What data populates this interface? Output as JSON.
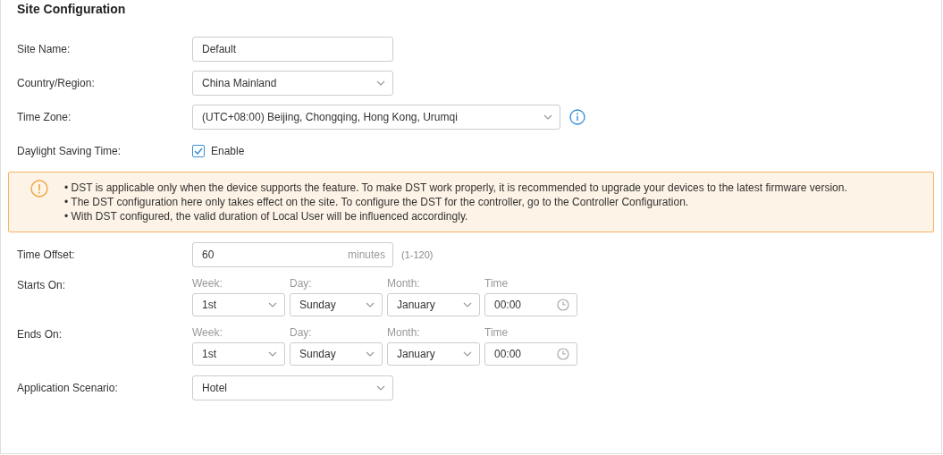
{
  "title": "Site Configuration",
  "site_name": {
    "label": "Site Name:",
    "value": "Default"
  },
  "country": {
    "label": "Country/Region:",
    "value": "China Mainland"
  },
  "time_zone": {
    "label": "Time Zone:",
    "value": "(UTC+08:00) Beijing, Chongqing, Hong Kong, Urumqi"
  },
  "dst": {
    "label": "Daylight Saving Time:",
    "checkbox_label": "Enable",
    "checked": true
  },
  "notice": [
    "• DST is applicable only when the device supports the feature. To make DST work properly, it is recommended to upgrade your devices to the latest firmware version.",
    "• The DST configuration here only takes effect on the site. To configure the DST for the controller, go to the Controller Configuration.",
    "• With DST configured, the valid duration of Local User will be influenced accordingly."
  ],
  "time_offset": {
    "label": "Time Offset:",
    "value": "60",
    "unit": "minutes",
    "hint": "(1-120)"
  },
  "schedule": [
    {
      "label": "Starts On:",
      "fields": [
        {
          "kind": "select",
          "label": "Week:",
          "value": "1st"
        },
        {
          "kind": "select",
          "label": "Day:",
          "value": "Sunday"
        },
        {
          "kind": "select",
          "label": "Month:",
          "value": "January"
        },
        {
          "kind": "time",
          "label": "Time",
          "value": "00:00"
        }
      ]
    },
    {
      "label": "Ends On:",
      "fields": [
        {
          "kind": "select",
          "label": "Week:",
          "value": "1st"
        },
        {
          "kind": "select",
          "label": "Day:",
          "value": "Sunday"
        },
        {
          "kind": "select",
          "label": "Month:",
          "value": "January"
        },
        {
          "kind": "time",
          "label": "Time",
          "value": "00:00"
        }
      ]
    }
  ],
  "scenario": {
    "label": "Application Scenario:",
    "value": "Hotel"
  }
}
